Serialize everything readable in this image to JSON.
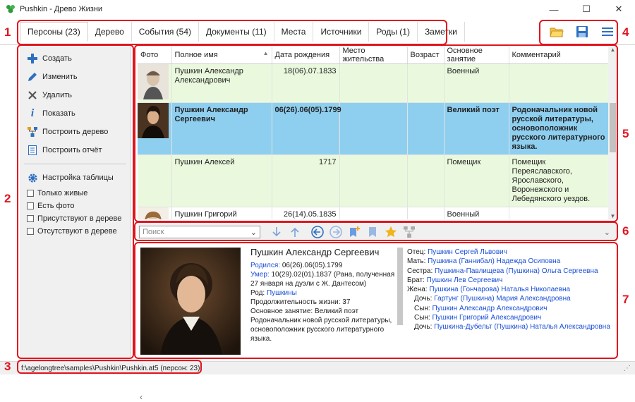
{
  "window": {
    "title": "Pushkin - Древо Жизни",
    "minimize": "—",
    "maximize": "☐",
    "close": "✕"
  },
  "tabs": [
    {
      "label": "Персоны (23)",
      "active": true
    },
    {
      "label": "Дерево"
    },
    {
      "label": "События (54)"
    },
    {
      "label": "Документы (11)"
    },
    {
      "label": "Места"
    },
    {
      "label": "Источники"
    },
    {
      "label": "Роды (1)"
    },
    {
      "label": "Заметки"
    }
  ],
  "toolbar": {
    "icons": [
      "open-folder-icon",
      "save-icon",
      "menu-icon"
    ]
  },
  "sidebar": {
    "actions": [
      {
        "label": "Создать",
        "icon": "plus-icon"
      },
      {
        "label": "Изменить",
        "icon": "pencil-icon"
      },
      {
        "label": "Удалить",
        "icon": "cross-icon"
      },
      {
        "label": "Показать",
        "icon": "info-icon"
      },
      {
        "label": "Построить дерево",
        "icon": "tree-icon"
      },
      {
        "label": "Построить отчёт",
        "icon": "report-icon"
      }
    ],
    "settings": "Настройка таблицы",
    "filters": [
      "Только живые",
      "Есть фото",
      "Присутствуют в дереве",
      "Отсутствуют в дереве"
    ]
  },
  "grid": {
    "columns": [
      "Фото",
      "Полное имя",
      "Дата рождения",
      "Место жительства",
      "Возраст",
      "Основное занятие",
      "Комментарий"
    ],
    "rows": [
      {
        "name": "Пушкин Александр Александрович",
        "birth": "18(06).07.1833",
        "residence": "",
        "age": "",
        "occupation": "Военный",
        "comment": "",
        "style": "g"
      },
      {
        "name": "Пушкин Александр Сергеевич",
        "birth": "06(26).06(05).1799",
        "residence": "",
        "age": "",
        "occupation": "Великий поэт",
        "comment": "Родоначальник новой русской литературы, основоположник русского литературного языка.",
        "style": "sel"
      },
      {
        "name": "Пушкин Алексей",
        "birth": "1717",
        "residence": "",
        "age": "",
        "occupation": "Помещик",
        "comment": "Помещик Переяславского, Ярославского, Воронежского и Лебедянского уездов.",
        "style": "g"
      },
      {
        "name": "Пушкин Григорий Александрович",
        "birth": "26(14).05.1835",
        "residence": "",
        "age": "",
        "occupation": "Военный",
        "comment": "",
        "style": "w"
      }
    ]
  },
  "searchbar": {
    "placeholder": "Поиск"
  },
  "details": {
    "name": "Пушкин Александр Сергеевич",
    "born_label": "Родился:",
    "born": "06(26).06(05).1799",
    "died_label": "Умер:",
    "died": "10(29).02(01).1837 (Рана, полученная 27 января на дуэли с Ж. Дантесом)",
    "clan_label": "Род:",
    "clan": "Пушкины",
    "lifespan": "Продолжительность жизни: 37",
    "occupation": "Основное занятие: Великий поэт",
    "comment": "Родоначальник новой русской литературы, основоположник русского литературного языка.",
    "relatives": [
      {
        "role": "Отец:",
        "name": "Пушкин Сергей Львович",
        "indent": false
      },
      {
        "role": "Мать:",
        "name": "Пушкина (Ганнибал) Надежда Осиповна",
        "indent": false
      },
      {
        "role": "Сестра:",
        "name": "Пушкина-Павлищева (Пушкина) Ольга Сергеевна",
        "indent": false
      },
      {
        "role": "Брат:",
        "name": "Пушкин Лев Сергеевич",
        "indent": false
      },
      {
        "role": "Жена:",
        "name": "Пушкина (Гончарова) Наталья Николаевна",
        "indent": false
      },
      {
        "role": "Дочь:",
        "name": "Гартунг (Пушкина) Мария Александровна",
        "indent": true
      },
      {
        "role": "Сын:",
        "name": "Пушкин Александр Александрович",
        "indent": true
      },
      {
        "role": "Сын:",
        "name": "Пушкин Григорий Александрович",
        "indent": true
      },
      {
        "role": "Дочь:",
        "name": "Пушкина-Дубельт (Пушкина) Наталья Александровна",
        "indent": true
      }
    ]
  },
  "status": {
    "text": "f:\\agelongtree\\samples\\Pushkin\\Pushkin.at5 (персон: 23)"
  },
  "callouts": [
    "1",
    "2",
    "3",
    "4",
    "5",
    "6",
    "7"
  ],
  "colors": {
    "accent": "#e0141e",
    "selected": "#8ecff0",
    "row_green": "#eaf9dd",
    "link": "#1a4fd6"
  }
}
